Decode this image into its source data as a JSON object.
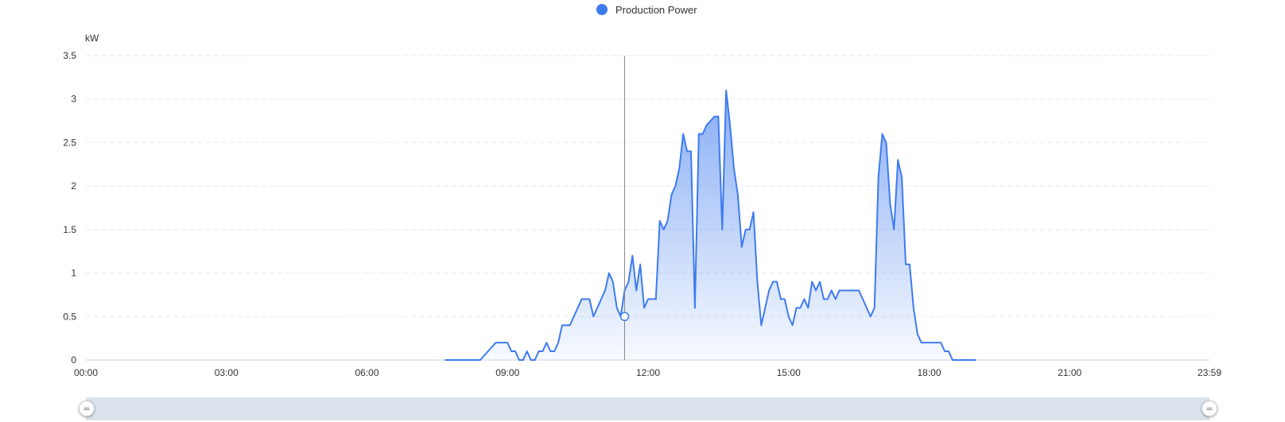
{
  "legend": {
    "label": "Production Power",
    "color": "#3e7bef"
  },
  "slider": {
    "handle_glyph": "="
  },
  "chart_data": {
    "type": "area",
    "title": "",
    "xlabel": "",
    "ylabel": "kW",
    "ylim": [
      0,
      3.5
    ],
    "yticks": [
      "0",
      "0.5",
      "1",
      "1.5",
      "2",
      "2.5",
      "3",
      "3.5"
    ],
    "xticks": [
      "00:00",
      "03:00",
      "06:00",
      "09:00",
      "12:00",
      "15:00",
      "18:00",
      "21:00",
      "23:59"
    ],
    "grid": true,
    "legend_position": "top-center",
    "series": [
      {
        "name": "Production Power",
        "color": "#3e7bef",
        "x": [
          "07:40",
          "08:00",
          "08:25",
          "08:45",
          "08:50",
          "09:00",
          "09:05",
          "09:10",
          "09:15",
          "09:20",
          "09:25",
          "09:30",
          "09:35",
          "09:40",
          "09:45",
          "09:50",
          "09:55",
          "10:00",
          "10:05",
          "10:10",
          "10:20",
          "10:30",
          "10:35",
          "10:45",
          "10:50",
          "11:05",
          "11:10",
          "11:15",
          "11:20",
          "11:25",
          "11:30",
          "11:35",
          "11:40",
          "11:45",
          "11:50",
          "11:55",
          "12:00",
          "12:05",
          "12:10",
          "12:15",
          "12:20",
          "12:25",
          "12:30",
          "12:35",
          "12:40",
          "12:45",
          "12:50",
          "12:55",
          "13:00",
          "13:05",
          "13:10",
          "13:15",
          "13:20",
          "13:25",
          "13:30",
          "13:35",
          "13:40",
          "13:45",
          "13:50",
          "13:55",
          "14:00",
          "14:05",
          "14:10",
          "14:15",
          "14:20",
          "14:25",
          "14:30",
          "14:35",
          "14:40",
          "14:45",
          "14:50",
          "14:55",
          "15:00",
          "15:05",
          "15:10",
          "15:15",
          "15:20",
          "15:25",
          "15:30",
          "15:35",
          "15:40",
          "15:45",
          "15:50",
          "15:55",
          "16:00",
          "16:05",
          "16:10",
          "16:15",
          "16:20",
          "16:30",
          "16:45",
          "16:50",
          "16:55",
          "17:00",
          "17:05",
          "17:10",
          "17:15",
          "17:20",
          "17:25",
          "17:30",
          "17:35",
          "17:40",
          "17:45",
          "17:50",
          "18:00",
          "18:15",
          "18:20",
          "18:25",
          "18:30",
          "19:00"
        ],
        "values": [
          0,
          0,
          0,
          0.2,
          0.2,
          0.2,
          0.1,
          0.1,
          0,
          0,
          0.1,
          0,
          0,
          0.1,
          0.1,
          0.2,
          0.1,
          0.1,
          0.2,
          0.4,
          0.4,
          0.6,
          0.7,
          0.7,
          0.5,
          0.8,
          1.0,
          0.9,
          0.6,
          0.5,
          0.8,
          0.9,
          1.2,
          0.8,
          1.1,
          0.6,
          0.7,
          0.7,
          0.7,
          1.6,
          1.5,
          1.6,
          1.9,
          2.0,
          2.2,
          2.6,
          2.4,
          2.4,
          0.6,
          2.6,
          2.6,
          2.7,
          2.75,
          2.8,
          2.8,
          1.5,
          3.1,
          2.7,
          2.2,
          1.9,
          1.3,
          1.5,
          1.5,
          1.7,
          0.9,
          0.4,
          0.6,
          0.8,
          0.9,
          0.9,
          0.7,
          0.7,
          0.5,
          0.4,
          0.6,
          0.6,
          0.7,
          0.6,
          0.9,
          0.8,
          0.9,
          0.7,
          0.7,
          0.8,
          0.7,
          0.8,
          0.8,
          0.8,
          0.8,
          0.8,
          0.5,
          0.6,
          2.1,
          2.6,
          2.5,
          1.8,
          1.5,
          2.3,
          2.1,
          1.1,
          1.1,
          0.6,
          0.3,
          0.2,
          0.2,
          0.2,
          0.1,
          0.1,
          0,
          0
        ]
      }
    ],
    "tooltip_marker": {
      "x": "11:30",
      "value": 0.5
    }
  }
}
